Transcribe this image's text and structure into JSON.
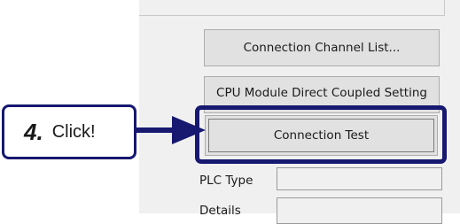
{
  "buttons": {
    "connection_channel_list": "Connection Channel List...",
    "cpu_direct_coupled": "CPU Module Direct Coupled Setting",
    "connection_test": "Connection Test"
  },
  "callout": {
    "step_number": "4.",
    "instruction": "Click!"
  },
  "fields": {
    "plc_type_label": "PLC Type",
    "plc_type_value": "",
    "details_label": "Details",
    "details_value": ""
  },
  "colors": {
    "highlight": "#17186f",
    "panel_bg": "#f0f0f0",
    "button_bg": "#e1e1e1"
  },
  "icons": {
    "arrow": "right-arrow-icon"
  }
}
